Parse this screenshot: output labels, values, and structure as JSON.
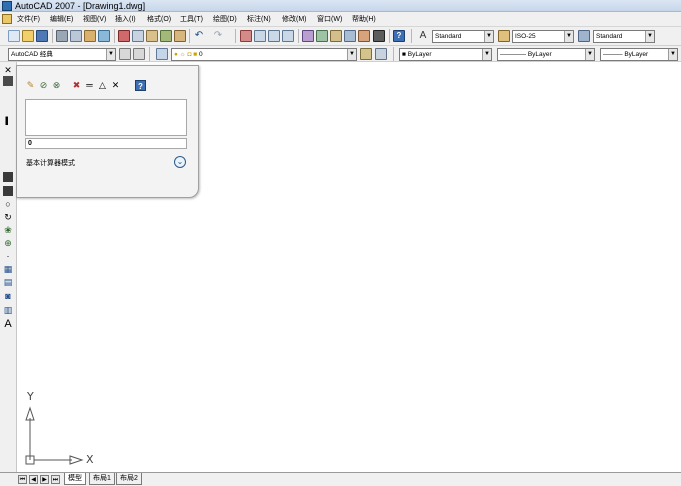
{
  "window": {
    "title": "AutoCAD 2007 - [Drawing1.dwg]"
  },
  "menu": {
    "items": [
      {
        "label": "文件(F)"
      },
      {
        "label": "编辑(E)"
      },
      {
        "label": "视图(V)"
      },
      {
        "label": "插入(I)"
      },
      {
        "label": "格式(O)"
      },
      {
        "label": "工具(T)"
      },
      {
        "label": "绘图(D)"
      },
      {
        "label": "标注(N)"
      },
      {
        "label": "修改(M)"
      },
      {
        "label": "窗口(W)"
      },
      {
        "label": "帮助(H)"
      }
    ]
  },
  "styles_toolbar": {
    "text_style": "Standard",
    "dim_style": "ISO-25",
    "table_style": "Standard"
  },
  "workspace": {
    "value": "AutoCAD 经典"
  },
  "layer": {
    "value": "0"
  },
  "properties": {
    "color": "ByLayer",
    "linetype": "ByLayer",
    "lineweight": "ByLayer"
  },
  "calculator": {
    "input_value": "0",
    "mode_label": "基本计算器模式"
  },
  "ucs": {
    "x_label": "X",
    "y_label": "Y"
  },
  "layout_tabs": {
    "items": [
      {
        "label": "模型"
      },
      {
        "label": "布局1"
      },
      {
        "label": "布局2"
      }
    ]
  },
  "colors": {
    "accent": "#2c5a8c",
    "toolbar_bg": "#f0f0f0"
  }
}
